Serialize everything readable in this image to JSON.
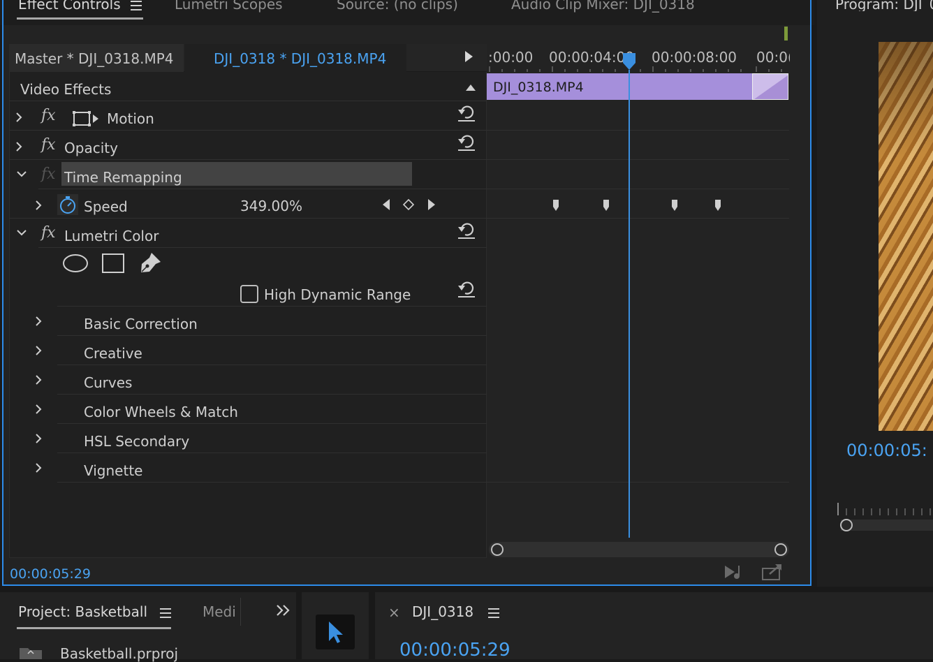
{
  "tabs": [
    {
      "label": "Effect Controls",
      "menu_icon": "hamburger-icon"
    },
    {
      "label": "Lumetri Scopes"
    },
    {
      "label": "Source: (no clips)"
    },
    {
      "label": "Audio Clip Mixer: DJI_0318"
    }
  ],
  "program": {
    "title": "Program: DJI_0",
    "timecode": "00:00:05:"
  },
  "effect_controls": {
    "master_label": "Master * DJI_0318.MP4",
    "sequence_label": "DJI_0318 * DJI_0318.MP4",
    "section": "Video Effects",
    "effects": [
      {
        "name": "Motion"
      },
      {
        "name": "Opacity"
      },
      {
        "name": "Time Remapping"
      },
      {
        "name": "Lumetri Color"
      }
    ],
    "speed": {
      "label": "Speed",
      "value": "349.00%"
    },
    "hdr_label": "High Dynamic Range",
    "lumetri_sections": [
      "Basic Correction",
      "Creative",
      "Curves",
      "Color Wheels & Match",
      "HSL Secondary",
      "Vignette"
    ],
    "timecode": "00:00:05:29"
  },
  "timeline": {
    "ruler_labels": [
      ":00:00",
      "00:00:04:00",
      "00:00:08:00",
      "00:0("
    ],
    "clip_name": "DJI_0318.MP4"
  },
  "project": {
    "tab": "Project: Basketball",
    "media_tab": "Medi",
    "item": "Basketball.prproj"
  },
  "sequence": {
    "name": "DJI_0318",
    "timecode": "00:00:05:29"
  },
  "colors": {
    "accent": "#2d8ceb",
    "clip": "#a58fdb",
    "timecode": "#4aa3f2"
  }
}
